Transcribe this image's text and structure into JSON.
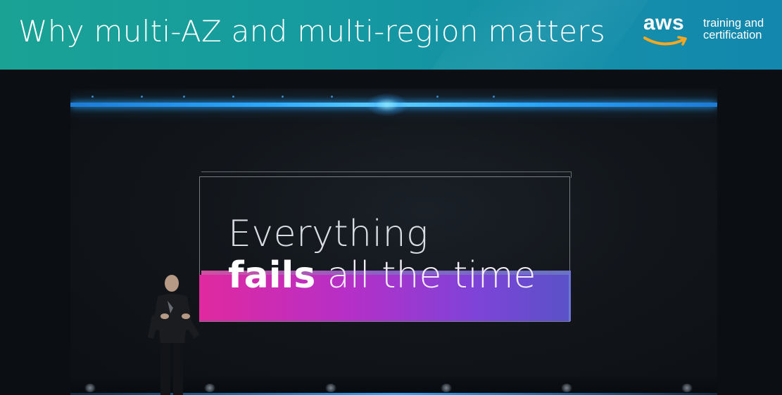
{
  "header": {
    "title": "Why multi-AZ and multi-region matters",
    "brand_logo_text": "aws",
    "tagline_line1": "training and",
    "tagline_line2": "certification"
  },
  "slide": {
    "line1": "Everything",
    "line2_bold": "fails",
    "line2_rest": " all the time"
  },
  "colors": {
    "header_start": "#1aa295",
    "header_end": "#1387ae",
    "bar_start": "#e0299f",
    "bar_end": "#5a52c8",
    "led": "#2aa8ff"
  },
  "icons": [
    "aws-smile-logo-icon"
  ]
}
